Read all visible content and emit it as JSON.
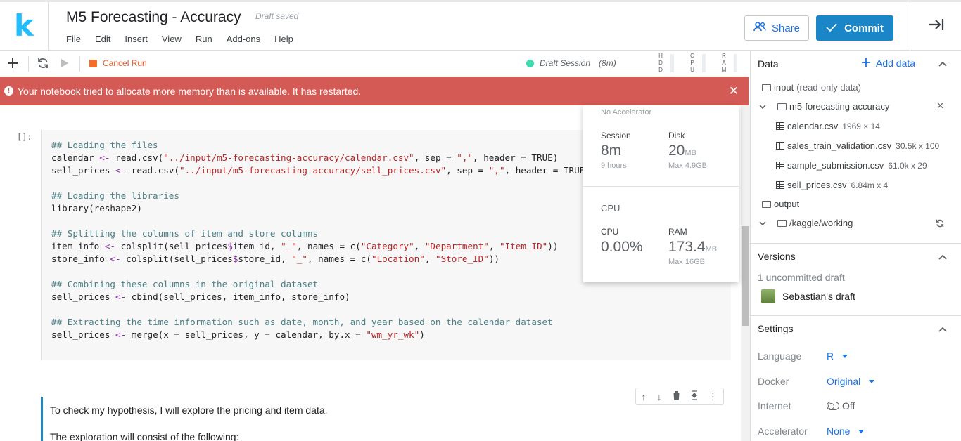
{
  "header": {
    "logo": "k",
    "title": "M5 Forecasting - Accuracy",
    "draft_status": "Draft saved",
    "menu": [
      "File",
      "Edit",
      "Insert",
      "View",
      "Run",
      "Add-ons",
      "Help"
    ],
    "share_label": "Share",
    "commit_label": "Commit"
  },
  "toolbar": {
    "cancel_run_label": "Cancel Run",
    "session_label": "Draft Session",
    "session_time": "(8m)",
    "meters": [
      "HDD",
      "CPU",
      "RAM"
    ]
  },
  "error_banner": {
    "message": "Your notebook tried to allocate more memory than is available. It has restarted."
  },
  "resources": {
    "accelerator": "No Accelerator",
    "session_label": "Session",
    "session_value": "8m",
    "session_sub": "9 hours",
    "disk_label": "Disk",
    "disk_value": "20",
    "disk_unit": "MB",
    "disk_sub": "Max 4.9GB",
    "cpu_heading": "CPU",
    "cpu_label": "CPU",
    "cpu_value": "0.00%",
    "ram_label": "RAM",
    "ram_value": "173.4",
    "ram_unit": "MB",
    "ram_sub": "Max 16GB"
  },
  "notebook": {
    "cell_prompt": "[]:",
    "markdown_p1": "To check my hypothesis, I will explore the pricing and item data.",
    "markdown_p2": "The exploration will consist of the following:"
  },
  "right_panel": {
    "data_heading": "Data",
    "add_data_label": "Add data",
    "input_label": "input",
    "input_note": "(read-only data)",
    "dataset": "m5-forecasting-accuracy",
    "files": [
      {
        "name": "calendar.csv",
        "meta": "1969 × 14"
      },
      {
        "name": "sales_train_validation.csv",
        "meta": "30.5k x 100"
      },
      {
        "name": "sample_submission.csv",
        "meta": "61.0k x 29"
      },
      {
        "name": "sell_prices.csv",
        "meta": "6.84m x 4"
      }
    ],
    "output_label": "output",
    "working_dir": "/kaggle/working",
    "versions_heading": "Versions",
    "uncommitted": "1 uncommitted draft",
    "draft_name": "Sebastian's draft",
    "settings_heading": "Settings",
    "settings": [
      {
        "label": "Language",
        "value": "R"
      },
      {
        "label": "Docker",
        "value": "Original"
      },
      {
        "label": "Internet",
        "value": "Off"
      },
      {
        "label": "Accelerator",
        "value": "None"
      }
    ]
  }
}
